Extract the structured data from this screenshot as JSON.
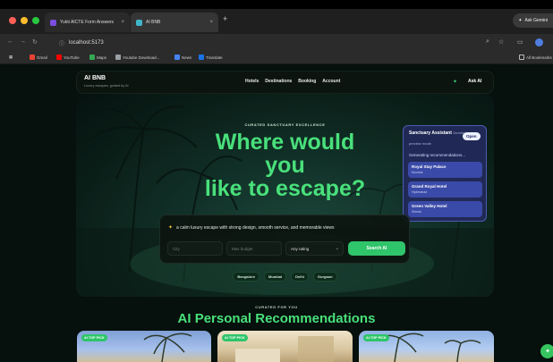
{
  "browser": {
    "tabs": [
      {
        "label": "Yukti AICTE Form Answers"
      },
      {
        "label": "AI BNB"
      }
    ],
    "new_tab_glyph": "+",
    "ask_gemini": "Ask Gemini",
    "url": "localhost:5173",
    "bookmarks": [
      "Gmail",
      "YouTube",
      "Maps",
      "Youtube Download...",
      "News",
      "Translate"
    ],
    "all_bookmarks": "All Bookmarks"
  },
  "app": {
    "brand": "AI BNB",
    "tagline": "Luxury escapes, guided by AI",
    "menu": [
      "Hotels",
      "Destinations",
      "Booking",
      "Account"
    ],
    "ask_ai": "Ask AI"
  },
  "hero": {
    "eyebrow": "CURATED SANCTUARY EXCELLENCE",
    "title_line1": "Where would",
    "title_line2": "you",
    "title_line3": "like to escape?",
    "search_prompt": "a calm luxury escape with strong design, smooth service, and memorable views",
    "city_placeholder": "City",
    "budget_placeholder": "Max budget",
    "rating_value": "Any rating",
    "search_button": "Search AI",
    "cities": [
      "Bangalore",
      "Mumbai",
      "Delhi",
      "Gurgaon"
    ]
  },
  "assistant": {
    "title": "Sanctuary Assistant",
    "title_suffix": "Gemini",
    "subtitle": "preview mode",
    "open": "Open",
    "status": "Generating recommendations...",
    "hotels": [
      {
        "name": "Royal Stay Palace",
        "city": "Mumbai"
      },
      {
        "name": "Grand Royal Hotel",
        "city": "Hyderabad"
      },
      {
        "name": "Green Valley Hotel",
        "city": "Shimla"
      }
    ]
  },
  "recommendations": {
    "eyebrow": "CURATED FOR YOU",
    "title": "AI Personal Recommendations",
    "badge": "AI TOP PICK"
  },
  "colors": {
    "accent_green": "#49e07b",
    "button_green": "#2fc56a",
    "panel_blue": "#222a5a"
  }
}
